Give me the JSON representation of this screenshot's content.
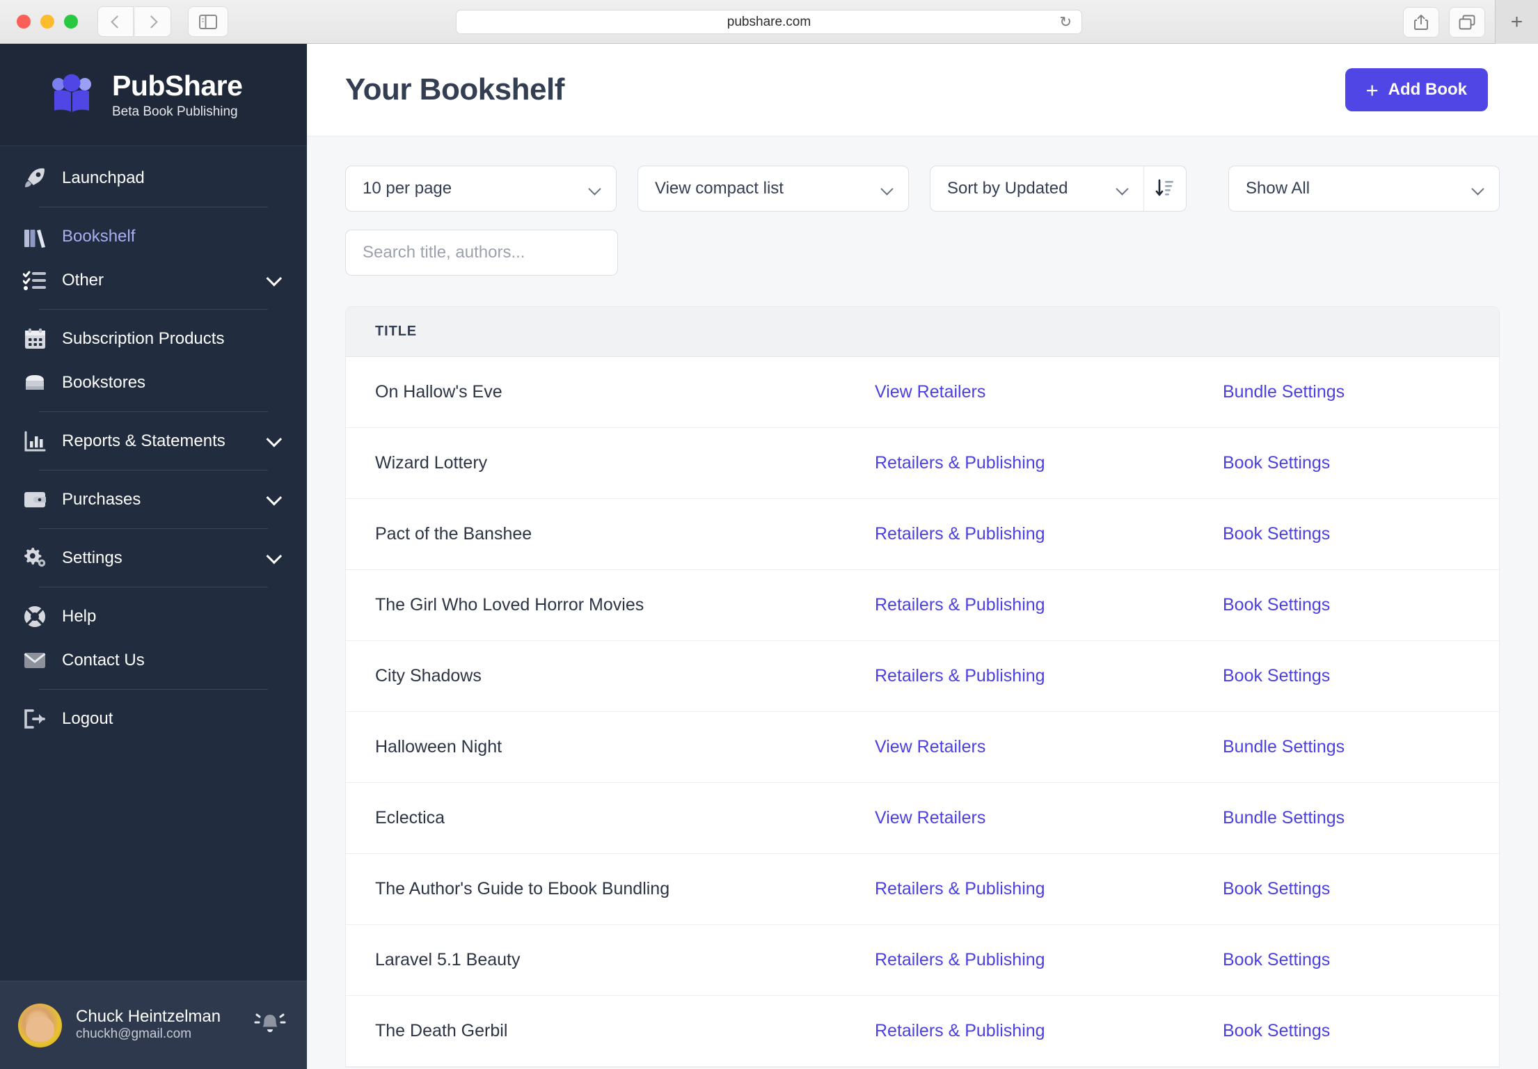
{
  "browser": {
    "url": "pubshare.com",
    "reload_icon": "reload-icon",
    "back_icon": "back-chevron-icon",
    "forward_icon": "forward-chevron-icon",
    "sidebar_toggle_icon": "sidebar-toggle-icon",
    "share_icon": "share-icon",
    "tabs_overview_icon": "tabs-overview-icon",
    "new_tab_label": "+"
  },
  "sidebar": {
    "brand": {
      "name": "PubShare",
      "tagline": "Beta Book Publishing",
      "logo_icon": "pubshare-logo-icon"
    },
    "items": [
      {
        "label": "Launchpad",
        "icon": "rocket-icon",
        "active": false,
        "expandable": false,
        "separator_after": true
      },
      {
        "label": "Bookshelf",
        "icon": "books-icon",
        "active": true,
        "expandable": false,
        "separator_after": false
      },
      {
        "label": "Other",
        "icon": "checklist-icon",
        "active": false,
        "expandable": true,
        "separator_after": true
      },
      {
        "label": "Subscription Products",
        "icon": "calendar-icon",
        "active": false,
        "expandable": false,
        "separator_after": false
      },
      {
        "label": "Bookstores",
        "icon": "storefront-icon",
        "active": false,
        "expandable": false,
        "separator_after": true
      },
      {
        "label": "Reports & Statements",
        "icon": "bar-chart-icon",
        "active": false,
        "expandable": true,
        "separator_after": true
      },
      {
        "label": "Purchases",
        "icon": "wallet-icon",
        "active": false,
        "expandable": true,
        "separator_after": true
      },
      {
        "label": "Settings",
        "icon": "gears-icon",
        "active": false,
        "expandable": true,
        "separator_after": true
      },
      {
        "label": "Help",
        "icon": "lifebuoy-icon",
        "active": false,
        "expandable": false,
        "separator_after": false
      },
      {
        "label": "Contact Us",
        "icon": "envelope-icon",
        "active": false,
        "expandable": false,
        "separator_after": true
      },
      {
        "label": "Logout",
        "icon": "logout-icon",
        "active": false,
        "expandable": false,
        "separator_after": false
      }
    ],
    "user": {
      "name": "Chuck Heintzelman",
      "email": "chuckh@gmail.com",
      "avatar_icon": "user-avatar",
      "notifications_icon": "bell-icon"
    }
  },
  "header": {
    "title": "Your Bookshelf",
    "add_book_label": "Add Book",
    "add_book_icon": "plus-icon",
    "accent_color": "#4f46e5"
  },
  "controls": {
    "per_page": {
      "value": "10 per page",
      "icon": "chevron-down-icon"
    },
    "view_mode": {
      "value": "View compact list",
      "icon": "chevron-down-icon"
    },
    "sort_by": {
      "value": "Sort by Updated",
      "icon": "chevron-down-icon"
    },
    "sort_direction": {
      "icon": "sort-descending-icon"
    },
    "show_filter": {
      "value": "Show All",
      "icon": "chevron-down-icon"
    },
    "search": {
      "value": "",
      "placeholder": "Search title, authors..."
    }
  },
  "table": {
    "columns": [
      "TITLE"
    ],
    "rows": [
      {
        "title": "On Hallow's Eve",
        "action1": "View Retailers",
        "action2": "Bundle Settings"
      },
      {
        "title": "Wizard Lottery",
        "action1": "Retailers & Publishing",
        "action2": "Book Settings"
      },
      {
        "title": "Pact of the Banshee",
        "action1": "Retailers & Publishing",
        "action2": "Book Settings"
      },
      {
        "title": "The Girl Who Loved Horror Movies",
        "action1": "Retailers & Publishing",
        "action2": "Book Settings"
      },
      {
        "title": "City Shadows",
        "action1": "Retailers & Publishing",
        "action2": "Book Settings"
      },
      {
        "title": "Halloween Night",
        "action1": "View Retailers",
        "action2": "Bundle Settings"
      },
      {
        "title": "Eclectica",
        "action1": "View Retailers",
        "action2": "Bundle Settings"
      },
      {
        "title": "The Author's Guide to Ebook Bundling",
        "action1": "Retailers & Publishing",
        "action2": "Book Settings"
      },
      {
        "title": "Laravel 5.1 Beauty",
        "action1": "Retailers & Publishing",
        "action2": "Book Settings"
      },
      {
        "title": "The Death Gerbil",
        "action1": "Retailers & Publishing",
        "action2": "Book Settings"
      }
    ],
    "link_color": "#4b3fe4"
  }
}
